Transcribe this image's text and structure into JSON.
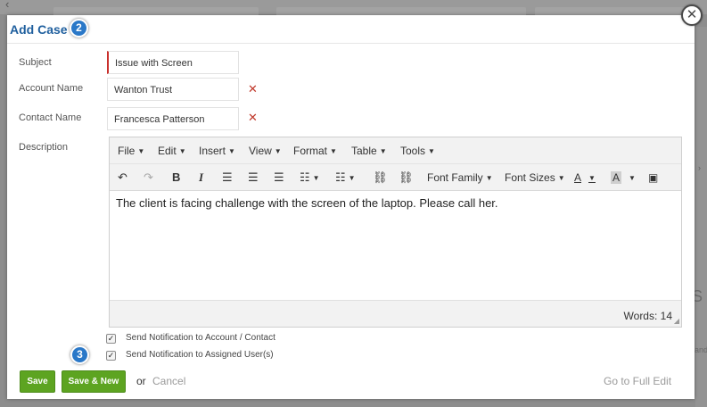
{
  "modal": {
    "title": "Add Case",
    "close_glyph": "✕"
  },
  "badges": {
    "title_step": "2",
    "notification_step": "3"
  },
  "form": {
    "subject": {
      "label": "Subject",
      "value": "Issue with Screen"
    },
    "account": {
      "label": "Account Name",
      "value": "Wanton Trust"
    },
    "contact": {
      "label": "Contact Name",
      "value": "Francesca Patterson"
    },
    "description": {
      "label": "Description"
    }
  },
  "editor": {
    "menu": [
      {
        "label": "File"
      },
      {
        "label": "Edit"
      },
      {
        "label": "Insert"
      },
      {
        "label": "View"
      },
      {
        "label": "Format"
      },
      {
        "label": "Table"
      },
      {
        "label": "Tools"
      }
    ],
    "toolbar": {
      "font_family_label": "Font Family",
      "font_sizes_label": "Font Sizes"
    },
    "content": "The client is facing challenge with the screen of the laptop. Please call her.",
    "word_count": "Words: 14"
  },
  "notifications": {
    "account_contact": {
      "label": "Send Notification to Account / Contact",
      "checked": true
    },
    "assigned_users": {
      "label": "Send Notification to Assigned User(s)",
      "checked": true
    }
  },
  "footer": {
    "save_label": "Save",
    "save_new_label": "Save & New",
    "or_text": "or",
    "cancel_label": "Cancel",
    "full_edit_label": "Go to Full Edit"
  },
  "background": {
    "right_letter": "S",
    "right_word": "and"
  },
  "colors": {
    "title": "#1f5f9e",
    "badge": "#2a78c8",
    "button_green": "#5da421",
    "required_marker": "#c9302c",
    "remove_x": "#c0392b"
  }
}
